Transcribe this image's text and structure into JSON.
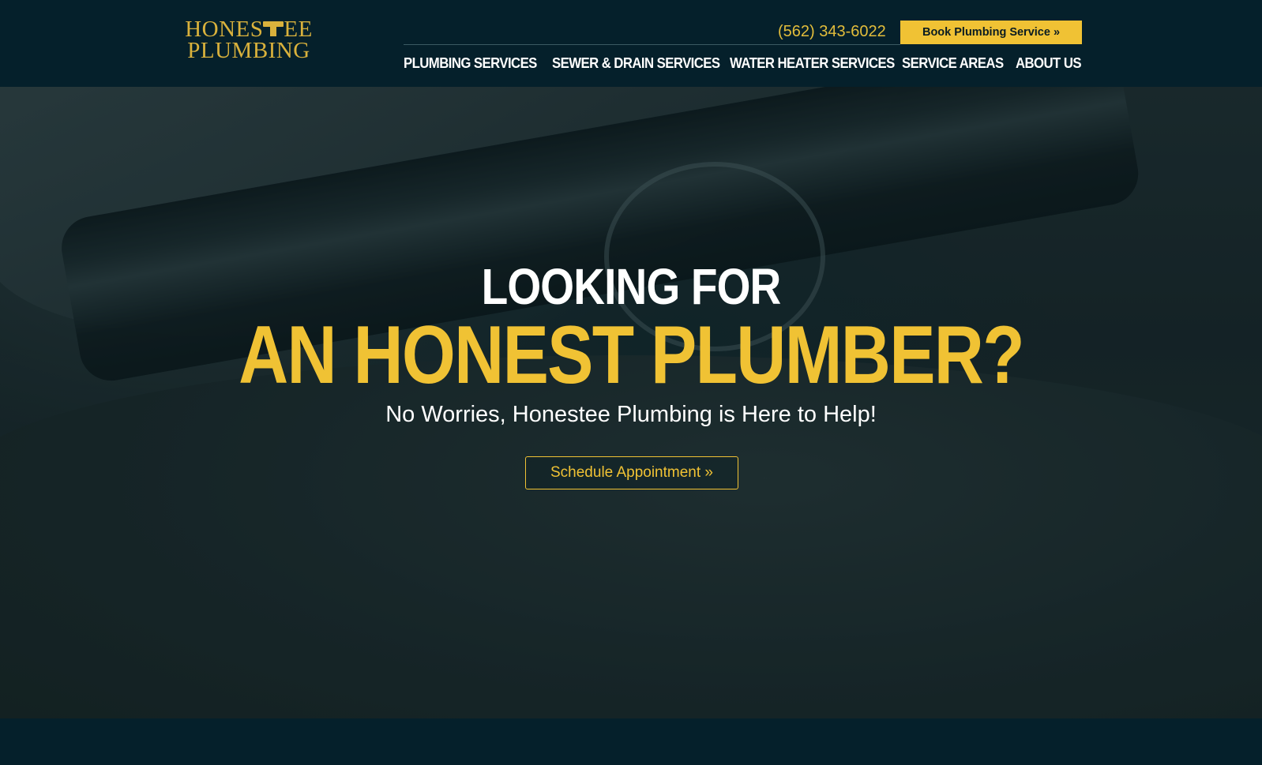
{
  "brand": {
    "logo_line1_pre": "HONES",
    "logo_line1_post": "EE",
    "logo_line2": "PLUMBING"
  },
  "header": {
    "phone": "(562) 343-6022",
    "book_button": "Book Plumbing Service »"
  },
  "nav": {
    "items": [
      "PLUMBING SERVICES",
      "SEWER & DRAIN SERVICES",
      "WATER HEATER SERVICES",
      "SERVICE AREAS",
      "ABOUT US"
    ]
  },
  "hero": {
    "line1": "LOOKING FOR",
    "line2": "AN HONEST PLUMBER?",
    "subtitle": "No Worries, Honestee Plumbing is Here to Help!",
    "cta": "Schedule Appointment »"
  },
  "colors": {
    "accent": "#f0c234",
    "header_bg": "#05202b",
    "logo_gold": "#d9b13c"
  }
}
